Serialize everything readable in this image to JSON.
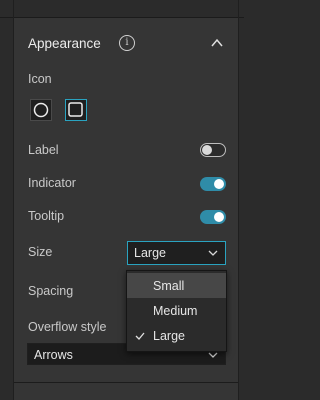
{
  "panel": {
    "title": "Appearance",
    "info_icon": "info-icon",
    "collapse_icon": "chevron-up-icon"
  },
  "icon_section": {
    "label": "Icon",
    "options": [
      {
        "name": "circle-icon",
        "selected": false
      },
      {
        "name": "square-icon",
        "selected": true
      }
    ]
  },
  "label_row": {
    "label": "Label",
    "enabled": false
  },
  "indicator_row": {
    "label": "Indicator",
    "enabled": true
  },
  "tooltip_row": {
    "label": "Tooltip",
    "enabled": true
  },
  "size_row": {
    "label": "Size",
    "selected": "Large",
    "options": [
      {
        "label": "Small",
        "hovered": true,
        "checked": false
      },
      {
        "label": "Medium",
        "hovered": false,
        "checked": false
      },
      {
        "label": "Large",
        "hovered": false,
        "checked": true
      }
    ]
  },
  "spacing_row": {
    "label": "Spacing"
  },
  "overflow_row": {
    "label": "Overflow style",
    "selected": "Arrows"
  },
  "colors": {
    "accent": "#2aa3c0",
    "toggle_on": "#2f8ca8",
    "panel_bg": "#353535",
    "outer_bg": "#2b2b2b"
  }
}
